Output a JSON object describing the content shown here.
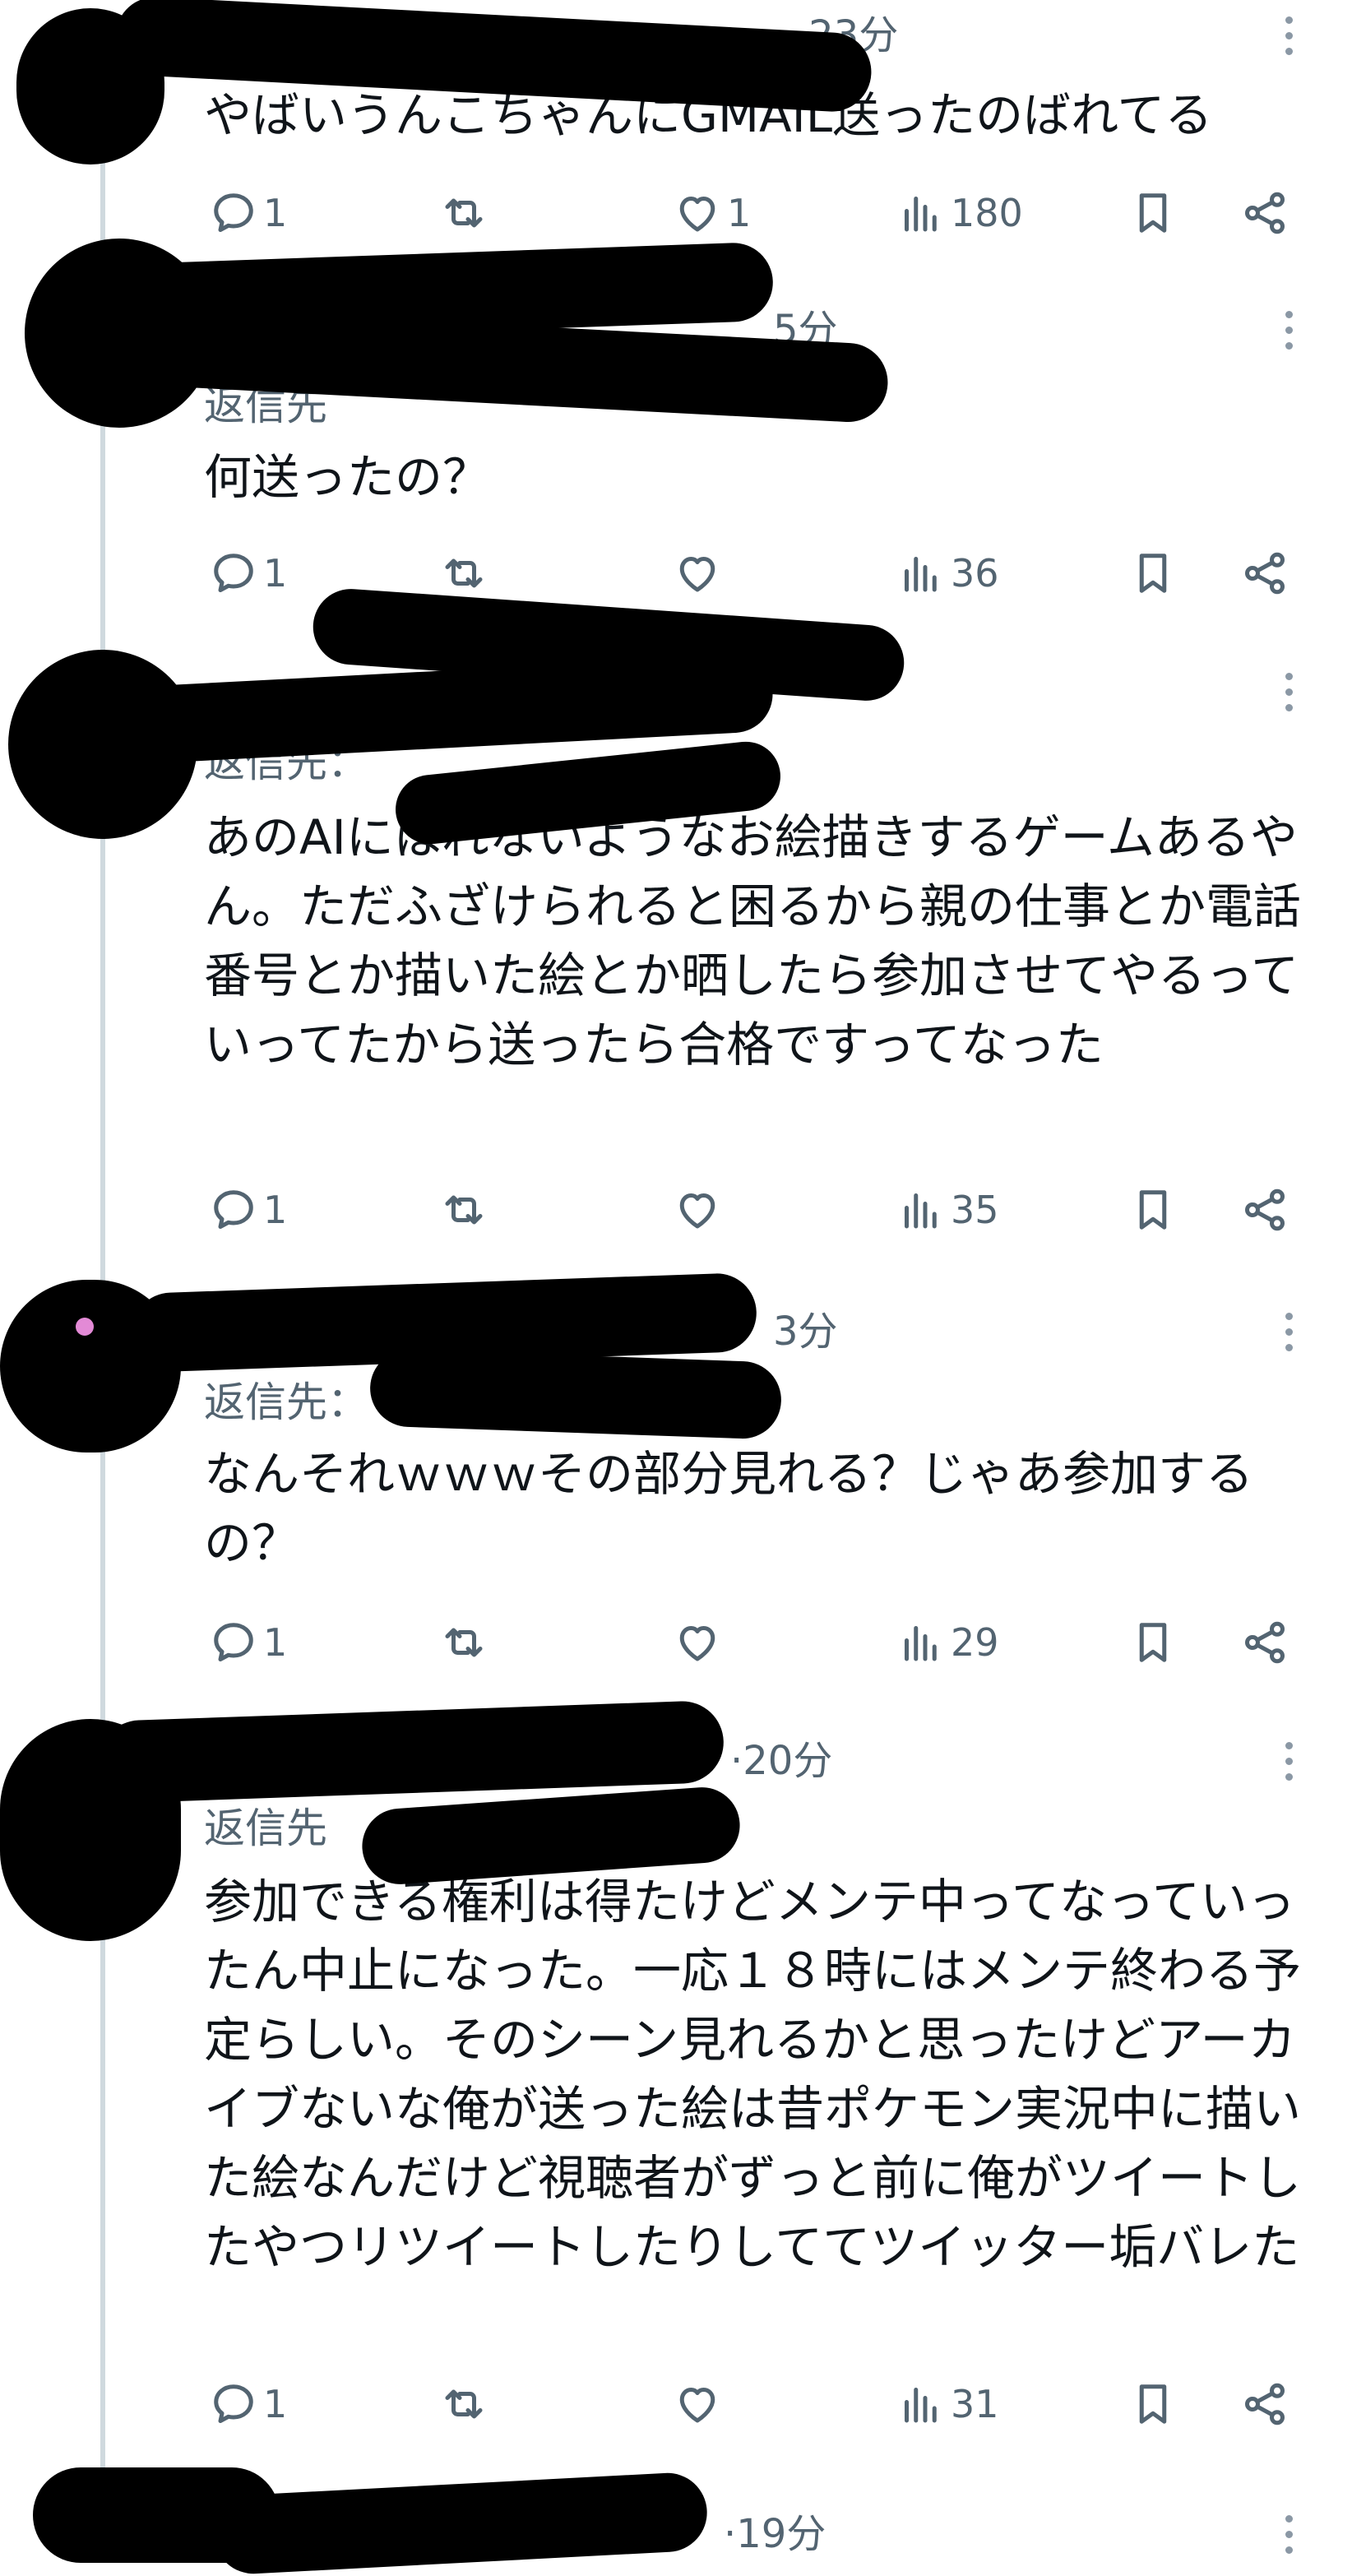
{
  "tweets": [
    {
      "time": "·23分",
      "reply_prefix": "",
      "text": "やばいうんこちゃんにGMAIL送ったのばれてる",
      "replies": "1",
      "retweets": "",
      "likes": "1",
      "views": "180"
    },
    {
      "time": "5分",
      "reply_prefix": "返信先",
      "text": "何送ったの？",
      "replies": "1",
      "retweets": "",
      "likes": "",
      "views": "36"
    },
    {
      "time": "",
      "reply_prefix": "返信先：",
      "text": "あのAIにはれないようなお絵描きするゲームあるやん。ただふざけられると困るから親の仕事とか電話番号とか描いた絵とか晒したら参加させてやるっていってたから送ったら合格ですってなった",
      "replies": "1",
      "retweets": "",
      "likes": "",
      "views": "35"
    },
    {
      "time": "3分",
      "reply_prefix": "返信先：",
      "text": "なんそれｗｗｗその部分見れる？じゃあ参加するの？",
      "replies": "1",
      "retweets": "",
      "likes": "",
      "views": "29"
    },
    {
      "time": "·20分",
      "reply_prefix": "返信先",
      "text": "参加できる権利は得たけどメンテ中ってなっていったん中止になった。一応１８時にはメンテ終わる予定らしい。そのシーン見れるかと思ったけどアーカイブないな俺が送った絵は昔ポケモン実況中に描いた絵なんだけど視聴者がずっと前に俺がツイートしたやつリツイートしたりしててツイッター垢バレた",
      "replies": "1",
      "retweets": "",
      "likes": "",
      "views": "31"
    },
    {
      "time": "·19分",
      "reply_prefix": "",
      "text": "",
      "replies": "",
      "retweets": "",
      "likes": "",
      "views": ""
    }
  ],
  "icons": {
    "reply": "reply-icon",
    "retweet": "retweet-icon",
    "like": "heart-icon",
    "views": "views-icon",
    "bookmark": "bookmark-icon",
    "share": "share-icon",
    "more": "more-icon"
  },
  "colors": {
    "text": "#0f1419",
    "secondary": "#536471",
    "link": "#1d9bf0",
    "thread_line": "#cfd9de",
    "redaction": "#000000"
  }
}
